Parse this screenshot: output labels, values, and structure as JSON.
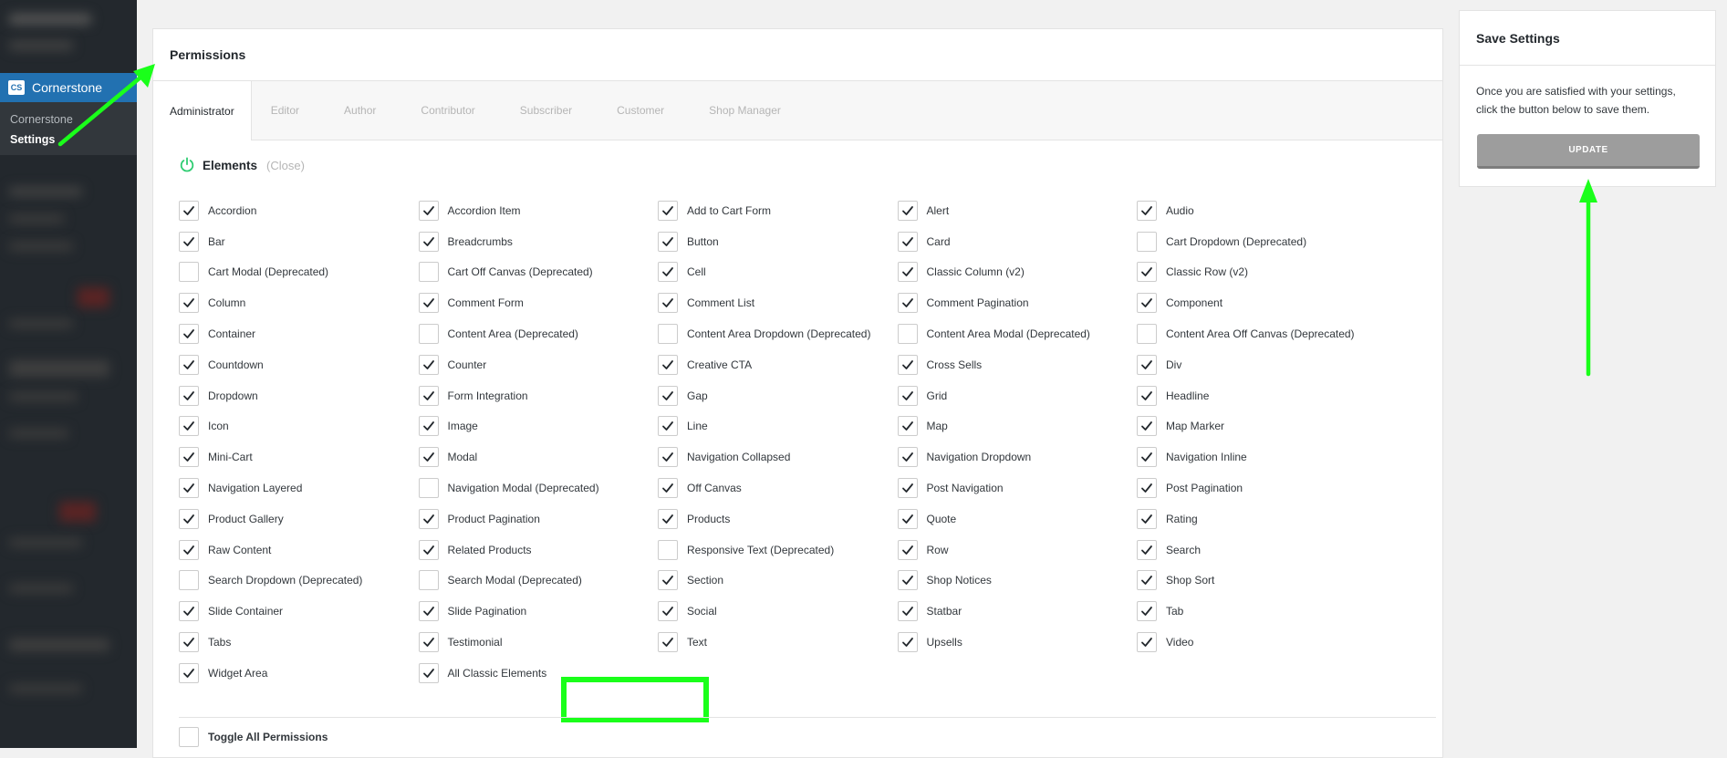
{
  "sidebar": {
    "plugin_logo": "CS",
    "active_menu": "Cornerstone",
    "submenu": [
      {
        "label": "Cornerstone",
        "current": false
      },
      {
        "label": "Settings",
        "current": true
      }
    ]
  },
  "main": {
    "title": "Permissions",
    "tabs": [
      "Administrator",
      "Editor",
      "Author",
      "Contributor",
      "Subscriber",
      "Customer",
      "Shop Manager"
    ],
    "active_tab": "Administrator",
    "section": {
      "title": "Elements",
      "close_label": "(Close)",
      "icon": "power-icon"
    },
    "permissions": [
      {
        "label": "Accordion",
        "checked": true
      },
      {
        "label": "Accordion Item",
        "checked": true
      },
      {
        "label": "Add to Cart Form",
        "checked": true
      },
      {
        "label": "Alert",
        "checked": true
      },
      {
        "label": "Audio",
        "checked": true
      },
      {
        "label": "Bar",
        "checked": true
      },
      {
        "label": "Breadcrumbs",
        "checked": true
      },
      {
        "label": "Button",
        "checked": true
      },
      {
        "label": "Card",
        "checked": true
      },
      {
        "label": "Cart Dropdown (Deprecated)",
        "checked": false
      },
      {
        "label": "Cart Modal (Deprecated)",
        "checked": false
      },
      {
        "label": "Cart Off Canvas (Deprecated)",
        "checked": false
      },
      {
        "label": "Cell",
        "checked": true
      },
      {
        "label": "Classic Column (v2)",
        "checked": true
      },
      {
        "label": "Classic Row (v2)",
        "checked": true
      },
      {
        "label": "Column",
        "checked": true
      },
      {
        "label": "Comment Form",
        "checked": true
      },
      {
        "label": "Comment List",
        "checked": true
      },
      {
        "label": "Comment Pagination",
        "checked": true
      },
      {
        "label": "Component",
        "checked": true
      },
      {
        "label": "Container",
        "checked": true
      },
      {
        "label": "Content Area (Deprecated)",
        "checked": false
      },
      {
        "label": "Content Area Dropdown (Deprecated)",
        "checked": false
      },
      {
        "label": "Content Area Modal (Deprecated)",
        "checked": false
      },
      {
        "label": "Content Area Off Canvas (Deprecated)",
        "checked": false
      },
      {
        "label": "Countdown",
        "checked": true
      },
      {
        "label": "Counter",
        "checked": true
      },
      {
        "label": "Creative CTA",
        "checked": true
      },
      {
        "label": "Cross Sells",
        "checked": true
      },
      {
        "label": "Div",
        "checked": true
      },
      {
        "label": "Dropdown",
        "checked": true
      },
      {
        "label": "Form Integration",
        "checked": true
      },
      {
        "label": "Gap",
        "checked": true
      },
      {
        "label": "Grid",
        "checked": true
      },
      {
        "label": "Headline",
        "checked": true
      },
      {
        "label": "Icon",
        "checked": true
      },
      {
        "label": "Image",
        "checked": true
      },
      {
        "label": "Line",
        "checked": true
      },
      {
        "label": "Map",
        "checked": true
      },
      {
        "label": "Map Marker",
        "checked": true
      },
      {
        "label": "Mini-Cart",
        "checked": true
      },
      {
        "label": "Modal",
        "checked": true
      },
      {
        "label": "Navigation Collapsed",
        "checked": true
      },
      {
        "label": "Navigation Dropdown",
        "checked": true
      },
      {
        "label": "Navigation Inline",
        "checked": true
      },
      {
        "label": "Navigation Layered",
        "checked": true
      },
      {
        "label": "Navigation Modal (Deprecated)",
        "checked": false
      },
      {
        "label": "Off Canvas",
        "checked": true
      },
      {
        "label": "Post Navigation",
        "checked": true
      },
      {
        "label": "Post Pagination",
        "checked": true
      },
      {
        "label": "Product Gallery",
        "checked": true
      },
      {
        "label": "Product Pagination",
        "checked": true
      },
      {
        "label": "Products",
        "checked": true
      },
      {
        "label": "Quote",
        "checked": true
      },
      {
        "label": "Rating",
        "checked": true
      },
      {
        "label": "Raw Content",
        "checked": true
      },
      {
        "label": "Related Products",
        "checked": true
      },
      {
        "label": "Responsive Text (Deprecated)",
        "checked": false
      },
      {
        "label": "Row",
        "checked": true
      },
      {
        "label": "Search",
        "checked": true
      },
      {
        "label": "Search Dropdown (Deprecated)",
        "checked": false
      },
      {
        "label": "Search Modal (Deprecated)",
        "checked": false
      },
      {
        "label": "Section",
        "checked": true
      },
      {
        "label": "Shop Notices",
        "checked": true
      },
      {
        "label": "Shop Sort",
        "checked": true
      },
      {
        "label": "Slide Container",
        "checked": true
      },
      {
        "label": "Slide Pagination",
        "checked": true
      },
      {
        "label": "Social",
        "checked": true
      },
      {
        "label": "Statbar",
        "checked": true
      },
      {
        "label": "Tab",
        "checked": true
      },
      {
        "label": "Tabs",
        "checked": true
      },
      {
        "label": "Testimonial",
        "checked": true
      },
      {
        "label": "Text",
        "checked": true
      },
      {
        "label": "Upsells",
        "checked": true
      },
      {
        "label": "Video",
        "checked": true
      },
      {
        "label": "Widget Area",
        "checked": true
      },
      {
        "label": "All Classic Elements",
        "checked": true
      }
    ],
    "toggle_all": {
      "label": "Toggle All Permissions",
      "checked": false
    }
  },
  "save": {
    "title": "Save Settings",
    "description": "Once you are satisfied with your settings, click the button below to save them.",
    "button_label": "UPDATE"
  },
  "colors": {
    "accent_blue": "#2271b1",
    "annotation_green": "#1aff1a",
    "power_icon_green": "#2ecc71",
    "button_gray": "#9d9d9d"
  }
}
